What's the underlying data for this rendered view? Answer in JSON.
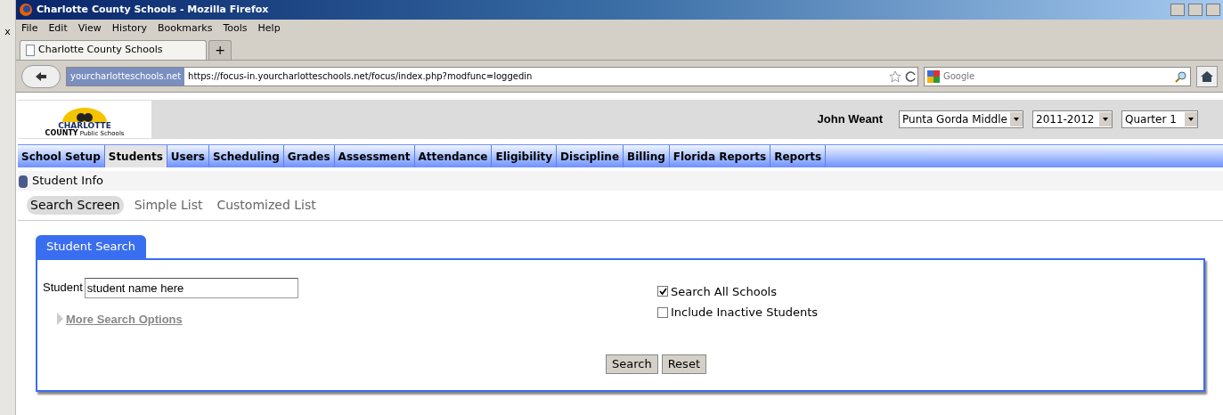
{
  "window": {
    "title": "Charlotte County Schools - Mozilla Firefox",
    "edge_mark": "x"
  },
  "menu": [
    "File",
    "Edit",
    "View",
    "History",
    "Bookmarks",
    "Tools",
    "Help"
  ],
  "browser_tabs": [
    {
      "label": "Charlotte County Schools",
      "selected": true
    },
    {
      "label": "+",
      "selected": false
    }
  ],
  "address_bar": {
    "site": "yourcharlotteschools.net",
    "url": "https://focus-in.yourcharlotteschools.net/focus/index.php?modfunc=loggedin"
  },
  "search_engine": {
    "placeholder": "Google"
  },
  "logo": {
    "name": "CHARLOTTE",
    "line2": "COUNTY",
    "line3": "Public Schools"
  },
  "user": "John Weant",
  "selectors": [
    {
      "value": "Punta Gorda Middle"
    },
    {
      "value": "2011-2012"
    },
    {
      "value": "Quarter 1"
    }
  ],
  "nav": [
    {
      "label": "School Setup",
      "selected": false
    },
    {
      "label": "Students",
      "selected": true
    },
    {
      "label": "Users",
      "selected": false
    },
    {
      "label": "Scheduling",
      "selected": false
    },
    {
      "label": "Grades",
      "selected": false
    },
    {
      "label": "Assessment",
      "selected": false
    },
    {
      "label": "Attendance",
      "selected": false
    },
    {
      "label": "Eligibility",
      "selected": false
    },
    {
      "label": "Discipline",
      "selected": false
    },
    {
      "label": "Billing",
      "selected": false
    },
    {
      "label": "Florida Reports",
      "selected": false
    },
    {
      "label": "Reports",
      "selected": false
    }
  ],
  "section": "Student Info",
  "subtabs": [
    {
      "label": "Search Screen",
      "selected": true
    },
    {
      "label": "Simple List",
      "selected": false
    },
    {
      "label": "Customized List",
      "selected": false
    }
  ],
  "panel": {
    "tab": "Student Search",
    "student_label": "Student",
    "student_value": "student name here",
    "more_options": "More Search Options",
    "checkboxes": [
      {
        "label": "Search All Schools",
        "checked": true
      },
      {
        "label": "Include Inactive Students",
        "checked": false
      }
    ],
    "buttons": [
      "Search",
      "Reset"
    ]
  }
}
